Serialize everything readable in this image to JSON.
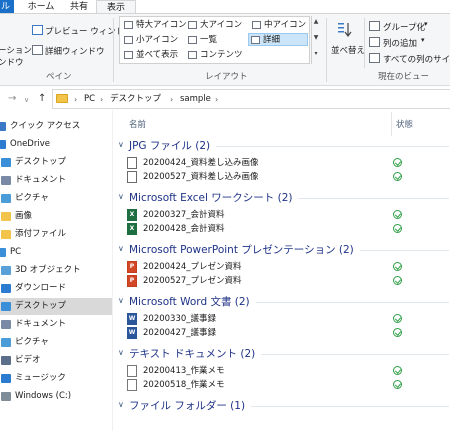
{
  "ribbon": {
    "tabs": {
      "file": "ル",
      "home": "ホーム",
      "share": "共有",
      "view": "表示"
    },
    "panes": {
      "navpane_line1": "ーション",
      "navpane_line2": "ンドウ",
      "preview": "プレビュー ウィンドウ",
      "details_pane": "詳細ウィンドウ",
      "group_label": "ペイン"
    },
    "layout": {
      "items": [
        "特大アイコン",
        "大アイコン",
        "中アイコン",
        "小アイコン",
        "一覧",
        "詳細",
        "並べて表示",
        "コンテンツ"
      ],
      "selected": "詳細",
      "group_label": "レイアウト"
    },
    "current_view": {
      "sort": "並べ替え",
      "group_by": "グループ化",
      "add_columns": "列の追加",
      "size_all_columns": "すべての列のサイズ",
      "group_label": "現在のビュー"
    }
  },
  "address": {
    "crumbs": [
      "PC",
      "デスクトップ",
      "sample"
    ]
  },
  "nav": {
    "items": [
      {
        "label": "クイック アクセス",
        "icon": "star-icon",
        "indent": 0
      },
      {
        "label": "OneDrive",
        "icon": "cloud-icon",
        "indent": 0
      },
      {
        "label": "デスクトップ",
        "icon": "desktop-icon",
        "indent": 1
      },
      {
        "label": "ドキュメント",
        "icon": "documents-icon",
        "indent": 1
      },
      {
        "label": "ピクチャ",
        "icon": "pictures-icon",
        "indent": 1
      },
      {
        "label": "画像",
        "icon": "folder-icon",
        "indent": 1
      },
      {
        "label": "添付ファイル",
        "icon": "folder-icon",
        "indent": 1
      },
      {
        "label": "PC",
        "icon": "pc-icon",
        "indent": 0
      },
      {
        "label": "3D オブジェクト",
        "icon": "3d-objects-icon",
        "indent": 1
      },
      {
        "label": "ダウンロード",
        "icon": "download-icon",
        "indent": 1
      },
      {
        "label": "デスクトップ",
        "icon": "desktop-icon",
        "indent": 1
      },
      {
        "label": "ドキュメント",
        "icon": "documents-icon",
        "indent": 1
      },
      {
        "label": "ピクチャ",
        "icon": "pictures-icon",
        "indent": 1
      },
      {
        "label": "ビデオ",
        "icon": "video-icon",
        "indent": 1
      },
      {
        "label": "ミュージック",
        "icon": "music-icon",
        "indent": 1
      },
      {
        "label": "Windows (C:)",
        "icon": "drive-icon",
        "indent": 1
      }
    ],
    "selected_label": "デスクトップ"
  },
  "columns": {
    "name": "名前",
    "status": "状態"
  },
  "groups": [
    {
      "title": "JPG ファイル (2)",
      "type": "img",
      "files": [
        "20200424_資料差し込み画像",
        "20200527_資料差し込み画像"
      ]
    },
    {
      "title": "Microsoft Excel ワークシート (2)",
      "type": "xl",
      "files": [
        "20200327_会計資料",
        "20200428_会計資料"
      ]
    },
    {
      "title": "Microsoft PowerPoint プレゼンテーション (2)",
      "type": "pp",
      "files": [
        "20200424_プレゼン資料",
        "20200527_プレゼン資料"
      ]
    },
    {
      "title": "Microsoft Word 文書 (2)",
      "type": "wd",
      "files": [
        "20200330_議事録",
        "20200427_議事録"
      ]
    },
    {
      "title": "テキスト ドキュメント (2)",
      "type": "txt",
      "files": [
        "20200413_作業メモ",
        "20200518_作業メモ"
      ]
    },
    {
      "title": "ファイル フォルダー (1)",
      "type": "folder",
      "files": []
    }
  ],
  "icon_letters": {
    "xl": "X",
    "pp": "P",
    "wd": "W"
  },
  "colors": {
    "accent": "#1a6fc9",
    "selection": "#cde8ff",
    "group_title": "#1e3287",
    "status_ok": "#2e9e46"
  }
}
